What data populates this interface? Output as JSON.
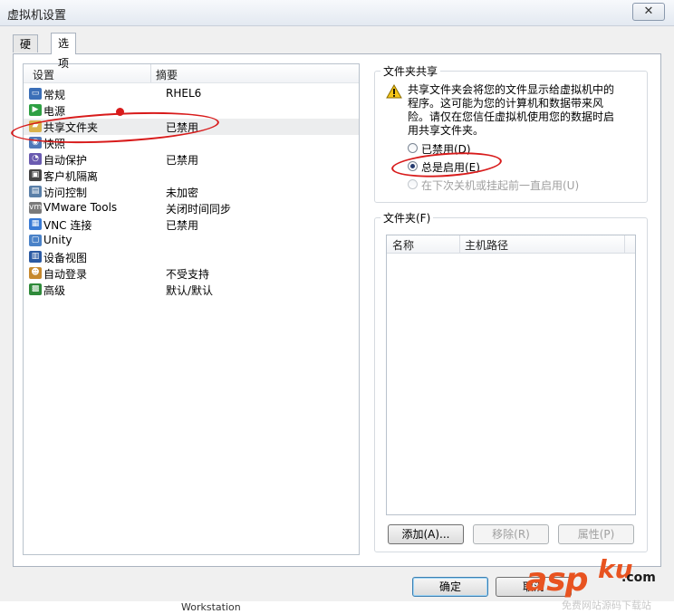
{
  "window": {
    "title": "虚拟机设置",
    "close_glyph": "✕"
  },
  "tabs": [
    {
      "label": "硬件",
      "active": false
    },
    {
      "label": "选项",
      "active": true
    }
  ],
  "settings_list": {
    "headers": {
      "setting": "设置",
      "summary": "摘要"
    },
    "rows": [
      {
        "name": "常规",
        "summary": "RHEL6",
        "icon": "monitor-icon",
        "color": "#3b6fb8"
      },
      {
        "name": "电源",
        "summary": "",
        "icon": "play-icon",
        "color": "#2ea043"
      },
      {
        "name": "共享文件夹",
        "summary": "已禁用",
        "icon": "shared-folder-icon",
        "color": "#d9b24a",
        "selected": true
      },
      {
        "name": "快照",
        "summary": "",
        "icon": "camera-icon",
        "color": "#5078b8"
      },
      {
        "name": "自动保护",
        "summary": "已禁用",
        "icon": "clock-icon",
        "color": "#6a5bb0"
      },
      {
        "name": "客户机隔离",
        "summary": "",
        "icon": "lock-icon",
        "color": "#444444"
      },
      {
        "name": "访问控制",
        "summary": "未加密",
        "icon": "access-control-icon",
        "color": "#5a7fa8"
      },
      {
        "name": "VMware Tools",
        "summary": "关闭时间同步",
        "icon": "vm-icon",
        "color": "#7a7a7a"
      },
      {
        "name": "VNC 连接",
        "summary": "已禁用",
        "icon": "vnc-icon",
        "color": "#3a7bd5"
      },
      {
        "name": "Unity",
        "summary": "",
        "icon": "unity-icon",
        "color": "#4a82c8"
      },
      {
        "name": "设备视图",
        "summary": "",
        "icon": "device-view-icon",
        "color": "#2b5aa3"
      },
      {
        "name": "自动登录",
        "summary": "不受支持",
        "icon": "users-icon",
        "color": "#c78a2e"
      },
      {
        "name": "高级",
        "summary": "默认/默认",
        "icon": "advanced-icon",
        "color": "#2f8a3a"
      }
    ]
  },
  "folder_sharing": {
    "title": "文件夹共享",
    "warning": "共享文件夹会将您的文件显示给虚拟机中的程序。这可能为您的计算机和数据带来风险。请仅在您信任虚拟机使用您的数据时启用共享文件夹。",
    "options": [
      {
        "label": "已禁用(D)",
        "checked": false,
        "disabled": false
      },
      {
        "label": "总是启用(E)",
        "checked": true,
        "disabled": false
      },
      {
        "label": "在下次关机或挂起前一直启用(U)",
        "checked": false,
        "disabled": true
      }
    ]
  },
  "folders": {
    "title": "文件夹(F)",
    "headers": {
      "name": "名称",
      "host_path": "主机路径"
    },
    "buttons": {
      "add": "添加(A)...",
      "remove": "移除(R)",
      "properties": "属性(P)"
    }
  },
  "dialog_buttons": {
    "ok": "确定",
    "cancel": "取消"
  },
  "annotation": {
    "marker": "1"
  },
  "watermark": {
    "brand_a": "asp",
    "brand_b": "ku",
    "brand_tld": ".com",
    "tagline": "免费网站源码下载站"
  },
  "background_text": "Workstation"
}
